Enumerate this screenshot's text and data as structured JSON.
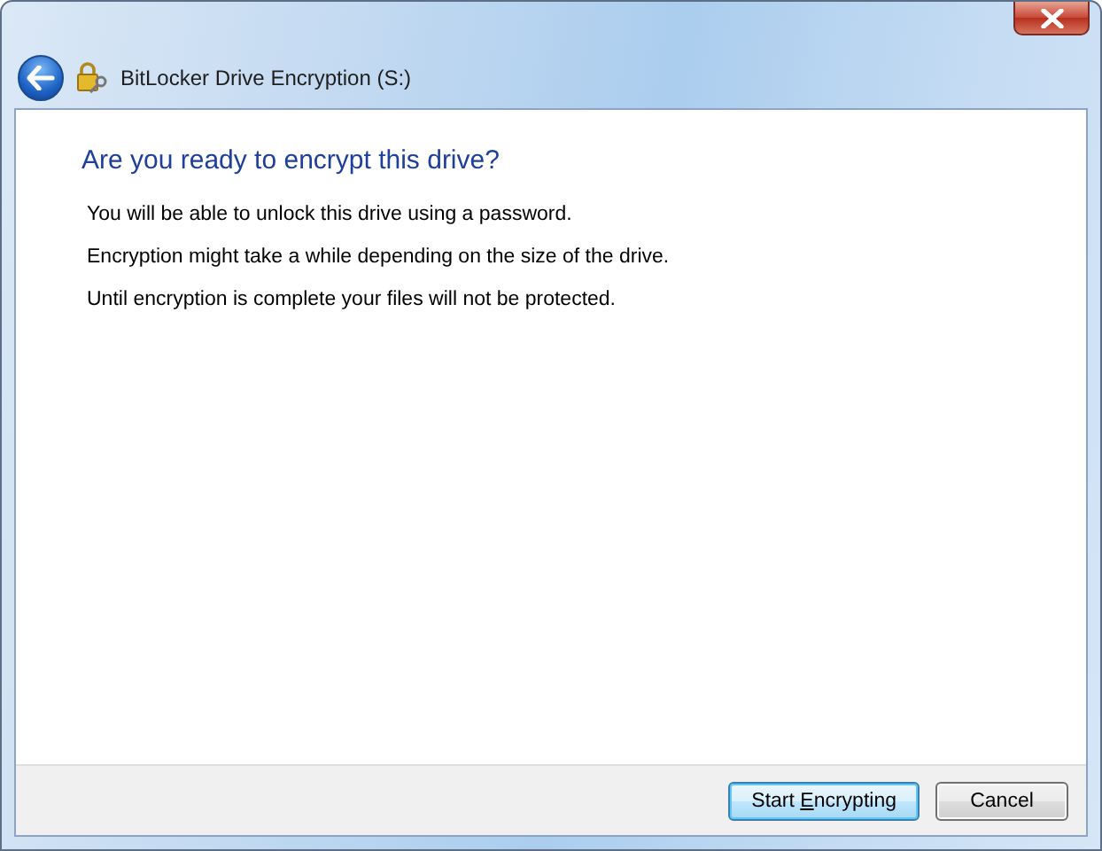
{
  "window": {
    "title": "BitLocker Drive Encryption (S:)"
  },
  "heading": "Are you ready to encrypt this drive?",
  "paragraphs": [
    "You will be able to unlock this drive using a password.",
    "Encryption might take a while depending on the size of the drive.",
    "Until encryption is complete your files will not be protected."
  ],
  "buttons": [
    {
      "label": "Start ",
      "access_key": "E",
      "label_rest": "ncrypting",
      "default": true
    },
    {
      "label": "Cancel",
      "default": false
    }
  ]
}
